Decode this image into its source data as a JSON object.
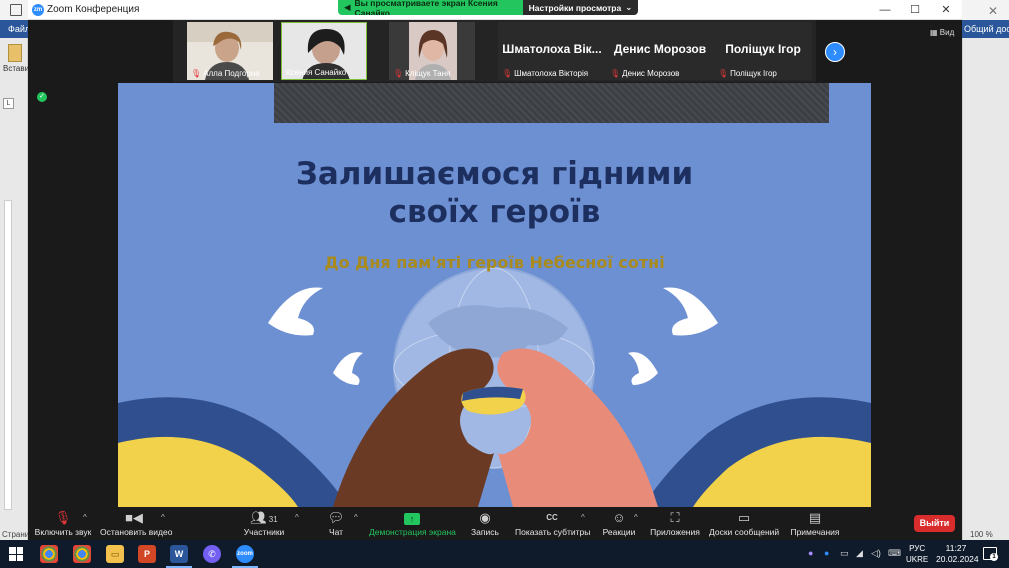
{
  "word": {
    "file_tab": "Файл",
    "share": "Общий доступ",
    "paste": "Встави",
    "ruler_marker": "L",
    "status_left": "Страни",
    "zoom_level": "100 %"
  },
  "zoom": {
    "window_title": "Zoom Конференция",
    "share_banner_text": "Вы просматриваете экран Ксения Санайко",
    "view_settings": "Настройки просмотра",
    "view_button": "Вид",
    "participants": [
      {
        "name": "Алла Подгорна",
        "has_video": true,
        "muted": true,
        "photo_color": "#c9b9a8"
      },
      {
        "name": "Ксения Санайко",
        "has_video": true,
        "muted": false,
        "photo_color": "#8a8f80"
      },
      {
        "name": "Кліщук Таня",
        "has_video": true,
        "muted": true,
        "photo_color": "#9c7a6a"
      },
      {
        "name": "Шматолоха Вікторія",
        "display": "Шматолоха Вік...",
        "has_video": false,
        "muted": true
      },
      {
        "name": "Денис Морозов",
        "display": "Денис Морозов",
        "has_video": false,
        "muted": true
      },
      {
        "name": "Поліщук Ігор",
        "display": "Поліщук Ігор",
        "has_video": false,
        "muted": true
      }
    ]
  },
  "slide": {
    "title_line1": "Залишаємося гідними",
    "title_line2": "своїх героїв",
    "subtitle": "До Дня пам'яті героїв Небесної сотні"
  },
  "toolbar": {
    "unmute": "Включить звук",
    "stop_video": "Остановить видео",
    "participants": "Участники",
    "participants_count": "31",
    "chat": "Чат",
    "share": "Демонстрация экрана",
    "record": "Запись",
    "captions": "Показать субтитры",
    "captions_icon": "CC",
    "reactions": "Реакции",
    "apps": "Приложения",
    "whiteboards": "Доски сообщений",
    "notes": "Примечания",
    "leave": "Выйти"
  },
  "taskbar": {
    "lang_line1": "РУС",
    "lang_line2": "UKRE",
    "time": "11:27",
    "date": "20.02.2024",
    "notification_count": "1",
    "pinned": [
      "chrome",
      "chrome-profile",
      "file-explorer",
      "powerpoint",
      "word",
      "viber",
      "zoom"
    ]
  },
  "colors": {
    "zoom_blue": "#2d8cff",
    "share_green": "#23c55e",
    "leave_red": "#d92d2d",
    "slide_bg": "#6d90d2",
    "flag_blue": "#2f4f8f",
    "flag_yellow": "#f2d24a"
  }
}
